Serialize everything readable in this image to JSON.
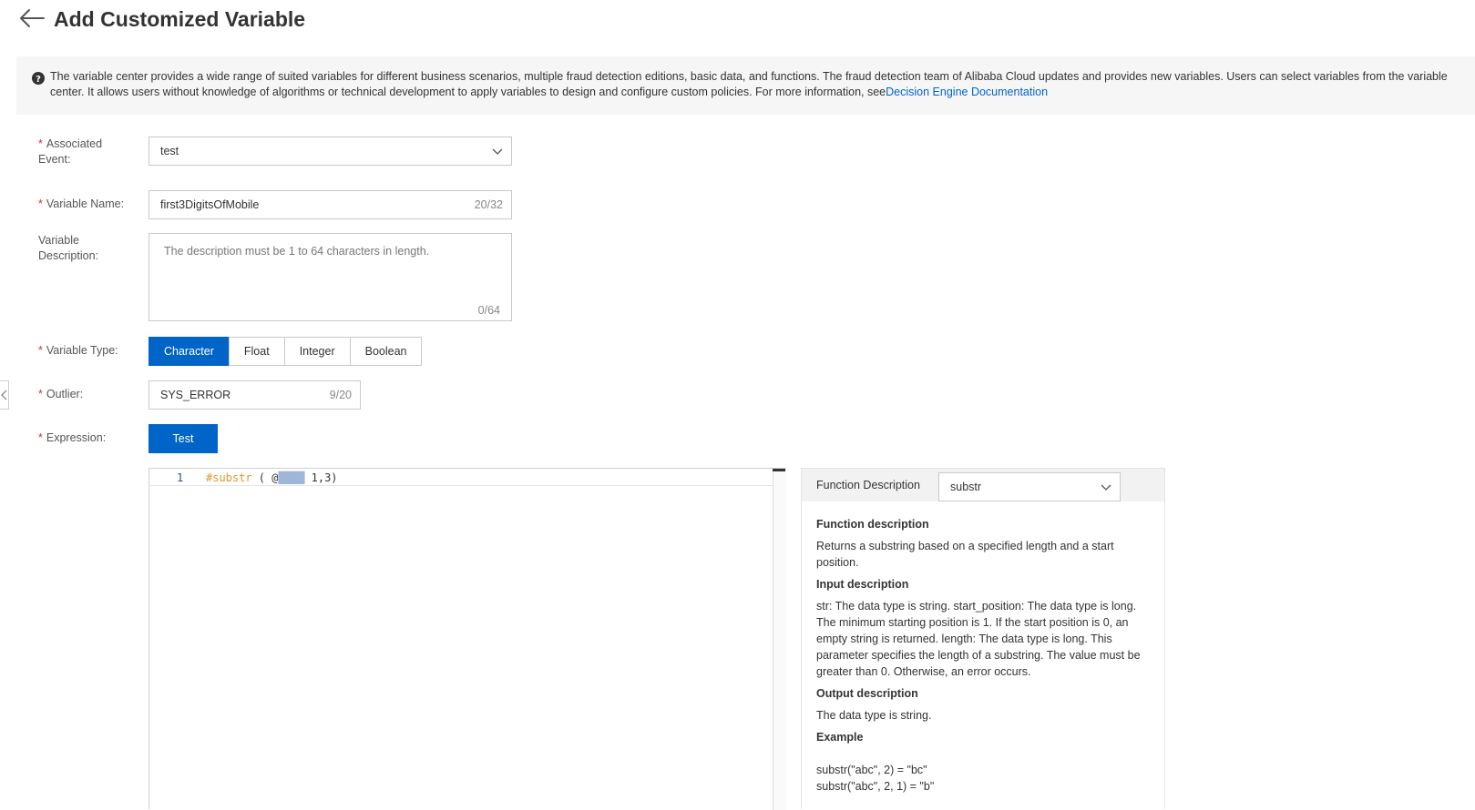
{
  "header": {
    "title": "Add Customized Variable"
  },
  "banner": {
    "text": "The variable center provides a wide range of suited variables for different business scenarios, multiple fraud detection editions, basic data, and functions. The fraud detection team of Alibaba Cloud updates and provides new variables. Users can select variables from the variable center. It allows users without knowledge of algorithms or technical development to apply variables to design and configure custom policies. For more information, see",
    "link": "Decision Engine Documentation"
  },
  "form": {
    "associated_event": {
      "label": "Associated Event:",
      "value": "test"
    },
    "variable_name": {
      "label": "Variable Name:",
      "value": "first3DigitsOfMobile",
      "count": "20/32"
    },
    "variable_description": {
      "label": "Variable Description:",
      "placeholder": "The description must be 1 to 64 characters in length.",
      "count": "0/64"
    },
    "variable_type": {
      "label": "Variable Type:",
      "options": [
        "Character",
        "Float",
        "Integer",
        "Boolean"
      ],
      "selected": "Character"
    },
    "outlier": {
      "label": "Outlier:",
      "value": "SYS_ERROR",
      "count": "9/20"
    },
    "expression": {
      "label": "Expression:",
      "test_label": "Test"
    }
  },
  "editor": {
    "line_number": "1",
    "code_fn": "#substr",
    "code_open": " ( @",
    "code_blurred": "████",
    "code_rest": " 1,3)"
  },
  "function_panel": {
    "label": "Function Description",
    "selected": "substr",
    "function_heading": "Function description",
    "function_text": "Returns a substring based on a specified length and a start position.",
    "input_heading": "Input description",
    "input_text": "str: The data type is string. start_position: The data type is long. The minimum starting position is 1. If the start position is 0, an empty string is returned. length: The data type is long. This parameter specifies the length of a substring. The value must be greater than 0. Otherwise, an error occurs.",
    "output_heading": "Output description",
    "output_text": "The data type is string.",
    "example_heading": "Example",
    "examples": [
      "substr(\"abc\", 2) = \"bc\"",
      "substr(\"abc\", 2, 1) = \"b\""
    ]
  },
  "colors": {
    "primary": "#0064c8",
    "required": "#d93026",
    "banner_bg": "#f6f6f6",
    "code_keyword": "#e0952b"
  },
  "icons": {
    "back": "arrow-left-icon",
    "help": "question-circle-icon",
    "dropdown": "chevron-down-icon",
    "collapse": "chevron-left-icon"
  }
}
